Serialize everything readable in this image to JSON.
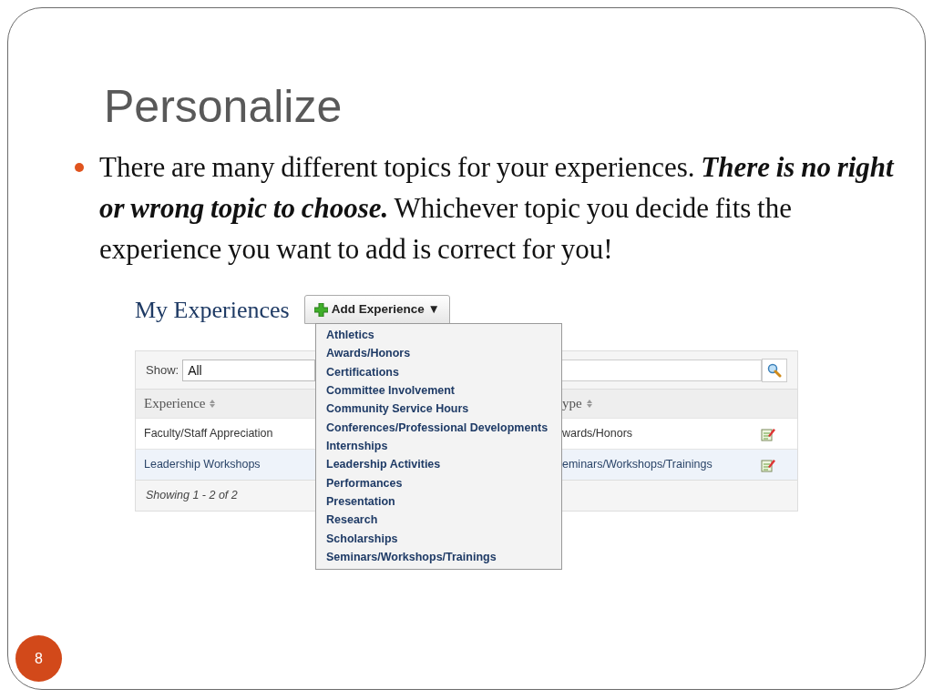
{
  "slide": {
    "title": "Personalize",
    "bullets": [
      {
        "text": "There are many different topics for your experiences.  **There is no right or wrong topic to choose.**  Whichever topic you decide fits the experience you want to add is correct for you!"
      }
    ],
    "page_number": "8"
  },
  "app": {
    "heading": "My Experiences",
    "add_button": {
      "label": "Add Experience",
      "caret": "▼"
    },
    "menu": {
      "items": [
        "Athletics",
        "Awards/Honors",
        "Certifications",
        "Committee Involvement",
        "Community Service Hours",
        "Conferences/Professional Developments",
        "Internships",
        "Leadership Activities",
        "Performances",
        "Presentation",
        "Research",
        "Scholarships",
        "Seminars/Workshops/Trainings"
      ]
    },
    "filter": {
      "label": "Show:",
      "value": "All"
    },
    "table": {
      "columns": [
        {
          "label": "Experience",
          "sortable": true
        },
        {
          "label": "ype",
          "sortable": true
        }
      ],
      "rows": [
        {
          "cells": [
            "Faculty/Staff Appreciation",
            "wards/Honors"
          ]
        },
        {
          "cells": [
            "Leadership Workshops",
            "eminars/Workshops/Trainings"
          ]
        }
      ],
      "footer": "Showing 1 - 2 of 2"
    }
  }
}
